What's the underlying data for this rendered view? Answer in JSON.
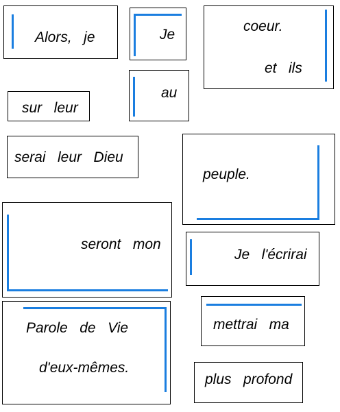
{
  "accent_color": "#1a7ee0",
  "cards": {
    "alors_je": "Alors,   je",
    "je": "Je",
    "coeur": "coeur.",
    "et_ils": "et   ils",
    "au": "au",
    "sur_leur": "sur   leur",
    "serai_leur_dieu": "serai   leur   Dieu",
    "peuple": "peuple.",
    "seront_mon": "seront   mon",
    "je_lecrirai": "Je   l'écrirai",
    "parole_de_vie": "Parole   de   Vie",
    "deux_memes": "d'eux-mêmes.",
    "mettrai_ma": "mettrai   ma",
    "plus_profond": "plus   profond"
  }
}
